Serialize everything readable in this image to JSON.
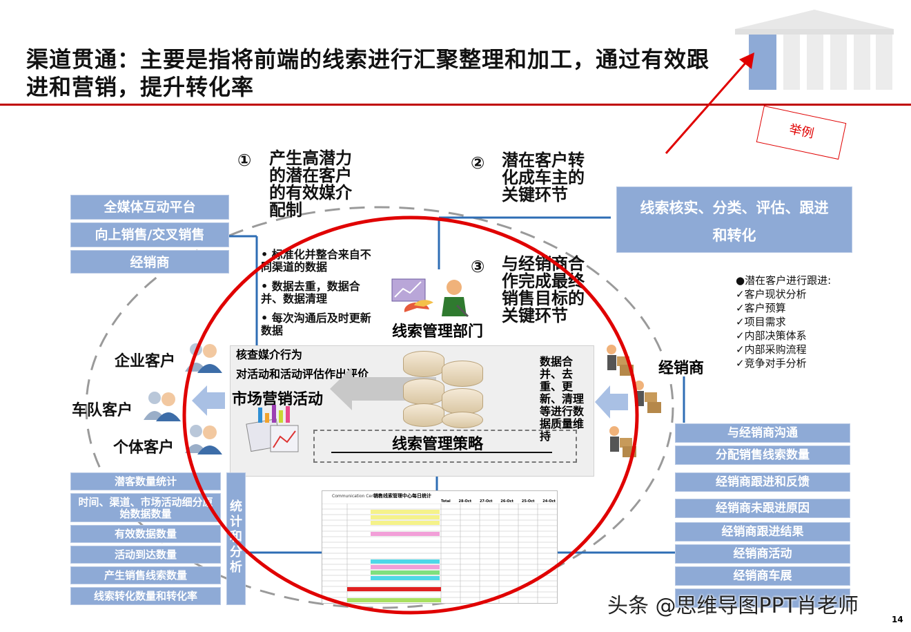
{
  "title": "渠道贯通：主要是指将前端的线索进行汇聚整理和加工，通过有效跟进和营销，提升转化率",
  "example_label": "举例",
  "left_top_boxes": [
    "全媒体互动平台",
    "向上销售/交叉销售",
    "经销商"
  ],
  "steps": [
    {
      "num": "①",
      "text": "产生高潜力的潜在客户的有效媒介配制"
    },
    {
      "num": "②",
      "text": "潜在客户转化成车主的关键环节"
    },
    {
      "num": "③",
      "text": "与经销商合作完成最终销售目标的关键环节"
    }
  ],
  "right_top_box": "线索核实、分类、评估、跟进和转化",
  "bullets": [
    "标准化并整合来自不同渠道的数据",
    "每次沟通后及时更新数据",
    "数据去重，数据合并、数据清理"
  ],
  "dept_label": "线索管理部门",
  "followup": {
    "heading": "●潜在客户进行跟进:",
    "items": [
      "✓客户现状分析",
      "✓客户预算",
      "✓项目需求",
      "✓内部决策体系",
      "✓内部采购流程",
      "✓竞争对手分析"
    ]
  },
  "customers": [
    "企业客户",
    "车队客户",
    "个体客户"
  ],
  "dealer_label": "经销商",
  "center": {
    "review_text_1": "核查媒介行为",
    "review_text_2": "对活动和活动评估作出评价",
    "market_label": "市场营销活动",
    "right_text": "数据合并、去重、更新、清理等进行数据质量维持",
    "strategy_label": "线索管理策略"
  },
  "left_bottom_boxes": [
    "潜客数量统计",
    "时间、渠道、市场活动细分原始数据数量",
    "有效数据数量",
    "活动到达数量",
    "产生销售线索数量",
    "线索转化数量和转化率"
  ],
  "vertical_label": "统计和分析",
  "right_bottom_boxes": [
    "与经销商沟通",
    "分配销售线索数量",
    "经销商跟进和反馈",
    "经销商未跟进原因",
    "经销商跟进结果",
    "经销商活动",
    "经销商车展"
  ],
  "table": {
    "header_left": "Communication Centre",
    "header_title": "销售线索管理中心每日统计",
    "columns": [
      "Total",
      "28-Oct",
      "27-Oct",
      "26-Oct",
      "25-Oct",
      "24-Oct"
    ]
  },
  "watermark": "头条 @思维导图PPT肖老师",
  "page_number": "14",
  "colors": {
    "accent_red": "#e00000",
    "box_blue": "#8eaad6",
    "line_blue": "#2e6db4"
  }
}
